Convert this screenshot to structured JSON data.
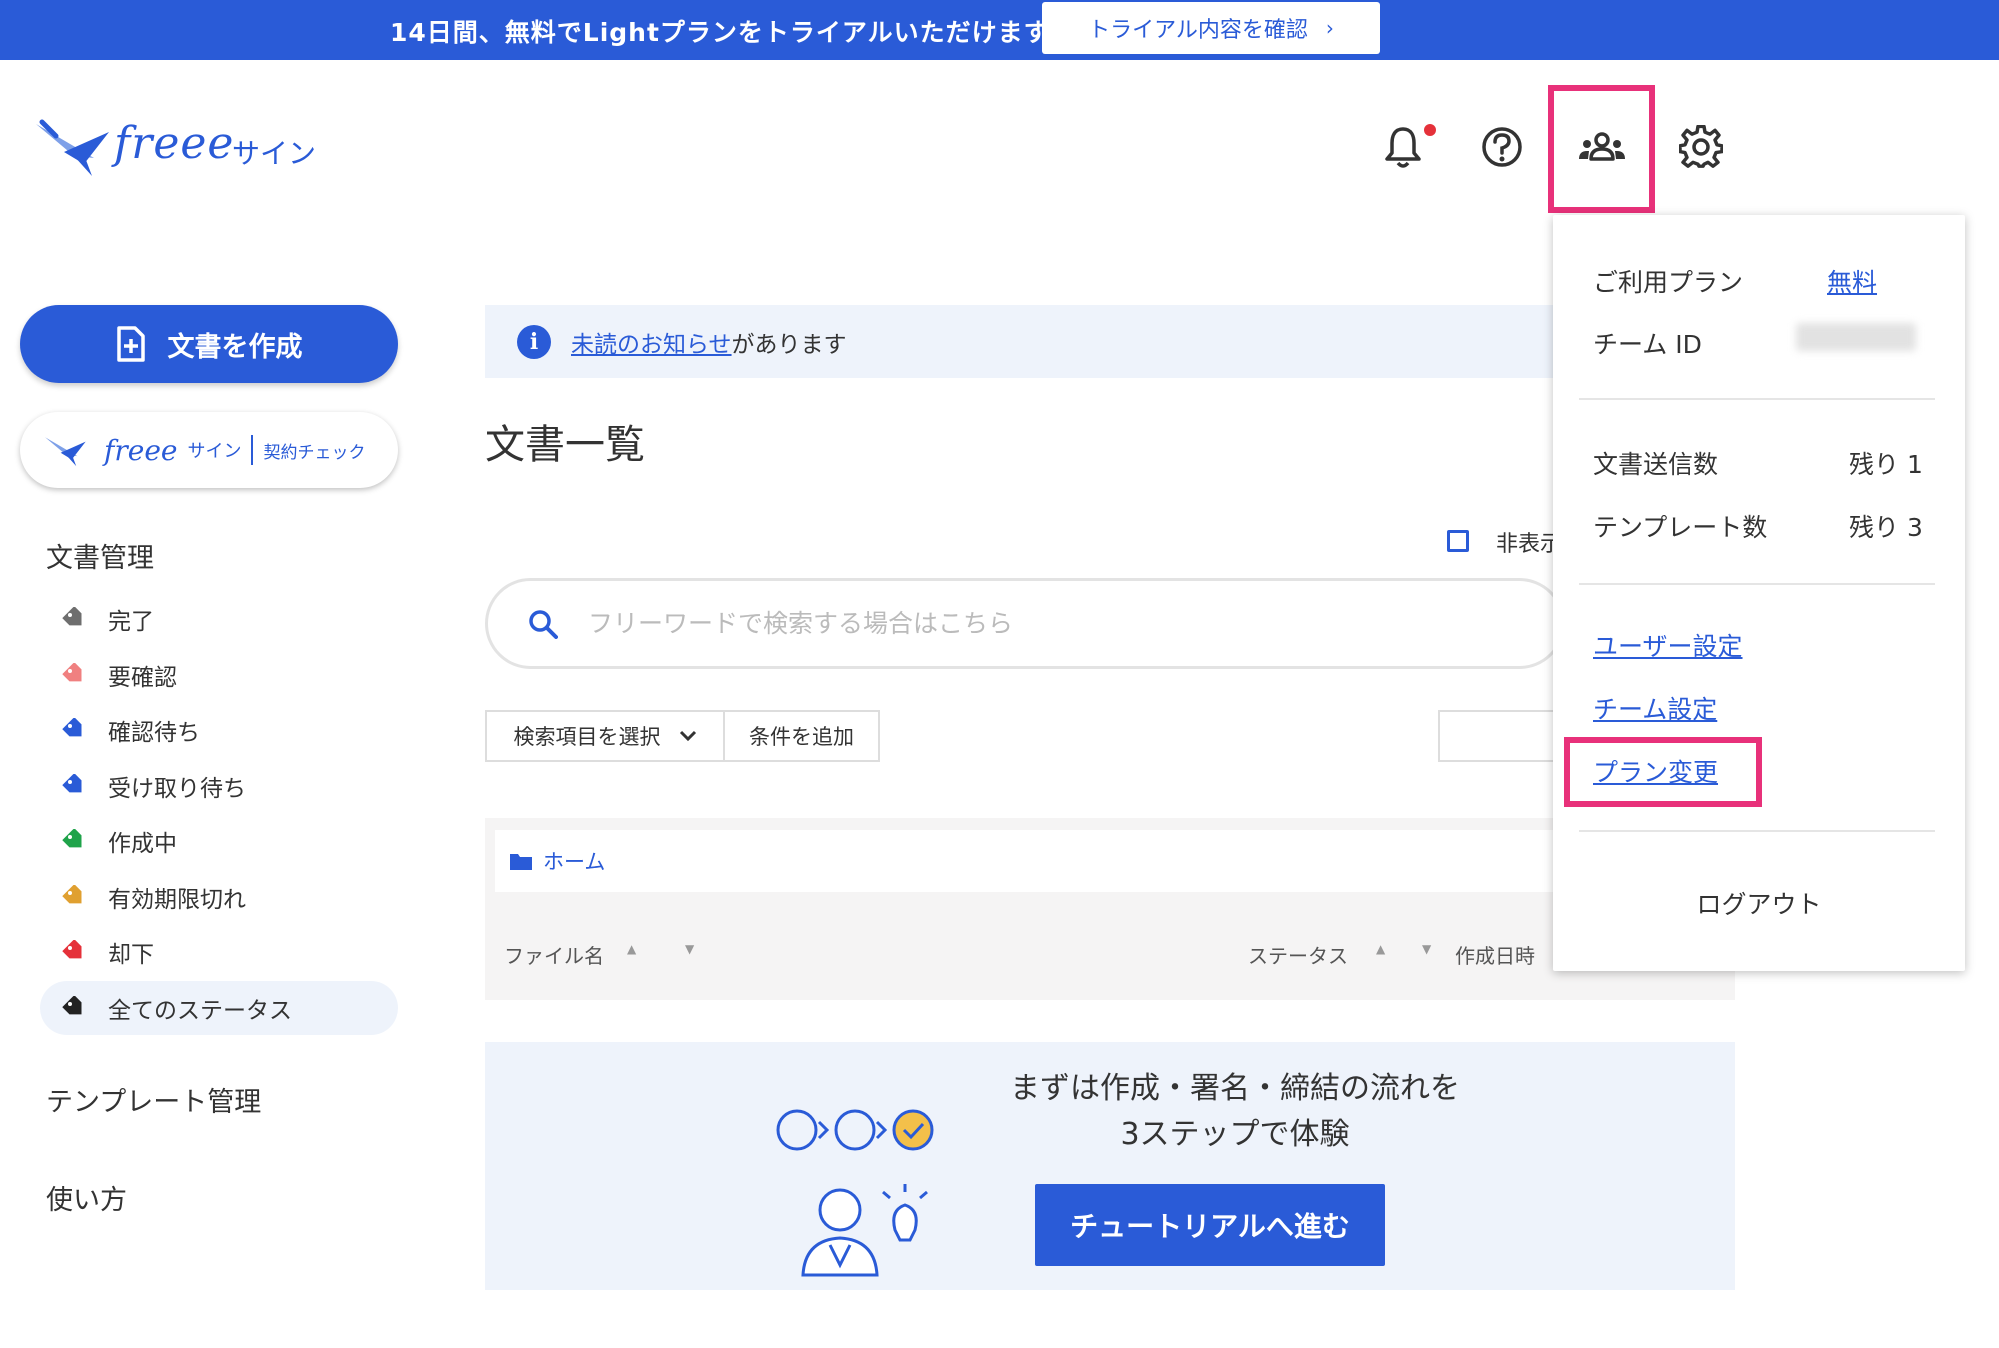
{
  "banner": {
    "text": "14日間、無料でLightプランをトライアルいただけます",
    "button_label": "トライアル内容を確認",
    "button_chevron": "›"
  },
  "header": {
    "logo_text": "freee",
    "logo_suffix": "サイン",
    "icons": [
      "bell-icon",
      "help-icon",
      "team-icon",
      "gear-icon"
    ]
  },
  "sidebar": {
    "create_button": "文書を作成",
    "check_logo": "freee",
    "check_logo_suffix": "サイン",
    "check_label": "契約チェック",
    "doc_mgmt_heading": "文書管理",
    "statuses": [
      {
        "label": "完了",
        "color": "#6e6e6e"
      },
      {
        "label": "要確認",
        "color": "#f08080"
      },
      {
        "label": "確認待ち",
        "color": "#2a5bd7"
      },
      {
        "label": "受け取り待ち",
        "color": "#2a5bd7"
      },
      {
        "label": "作成中",
        "color": "#1fa34a"
      },
      {
        "label": "有効期限切れ",
        "color": "#e0a030"
      },
      {
        "label": "却下",
        "color": "#e5313a"
      },
      {
        "label": "全てのステータス",
        "color": "#222222"
      }
    ],
    "template_heading": "テンプレート管理",
    "howto_heading": "使い方"
  },
  "main": {
    "notice_link": "未読のお知らせ",
    "notice_rest": "があります",
    "page_title": "文書一覧",
    "hide_label": "非表示",
    "search_placeholder": "フリーワードで検索する場合はこちら",
    "select_button": "検索項目を選択",
    "add_condition": "条件を追加",
    "breadcrumb": "ホーム",
    "col_filename": "ファイル名",
    "col_status": "ステータス",
    "col_created": "作成日時",
    "tutorial_line1": "まずは作成・署名・締結の流れを",
    "tutorial_line2": "3ステップで体験",
    "tutorial_button": "チュートリアルへ進む"
  },
  "dropdown": {
    "plan_label": "ご利用プラン",
    "plan_value": "無料",
    "team_id_label": "チーム ID",
    "send_label": "文書送信数",
    "send_value": "残り 1",
    "template_label": "テンプレート数",
    "template_value": "残り 3",
    "user_settings": "ユーザー設定",
    "team_settings": "チーム設定",
    "plan_change": "プラン変更",
    "logout": "ログアウト"
  },
  "colors": {
    "brand": "#2a5bd7",
    "highlight": "#e8317a"
  }
}
